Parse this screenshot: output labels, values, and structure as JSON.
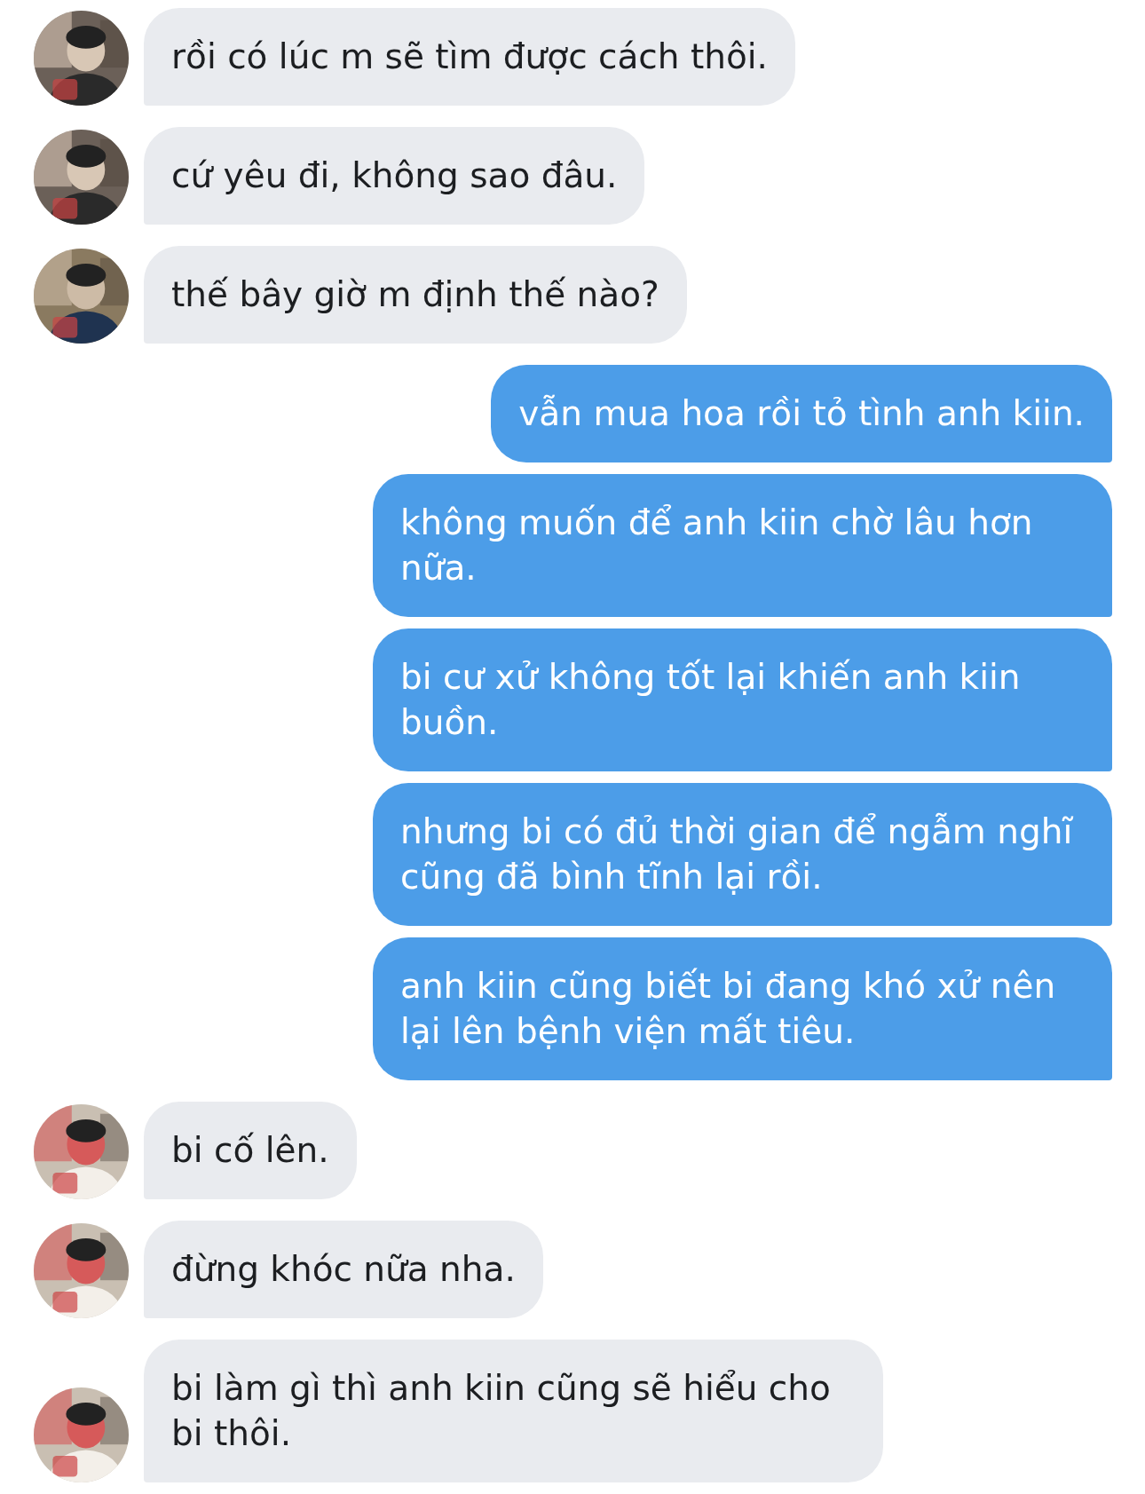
{
  "messages": [
    {
      "kind": "received",
      "text": "rồi có lúc m sẽ tìm được cách thôi."
    },
    {
      "kind": "received",
      "text": "cứ yêu đi, không sao đâu."
    },
    {
      "kind": "received",
      "text": "thế bây giờ m định thế nào?"
    },
    {
      "kind": "sent",
      "text": "vẫn mua hoa rồi tỏ tình anh kiin."
    },
    {
      "kind": "sent",
      "text": "không muốn để anh kiin chờ lâu hơn nữa."
    },
    {
      "kind": "sent",
      "text": "bi cư xử không tốt lại khiến anh kiin buồn."
    },
    {
      "kind": "sent",
      "text": "nhưng bi có đủ thời gian để ngẫm nghĩ cũng đã bình tĩnh lại rồi."
    },
    {
      "kind": "sent",
      "text": "anh kiin cũng biết bi đang khó xử nên lại lên bệnh viện mất tiêu."
    },
    {
      "kind": "received",
      "text": "bi cố lên."
    },
    {
      "kind": "received",
      "text": "đừng khóc nữa nha."
    },
    {
      "kind": "received",
      "text": "bi làm gì thì anh kiin cũng sẽ hiểu cho bi thôi."
    }
  ]
}
